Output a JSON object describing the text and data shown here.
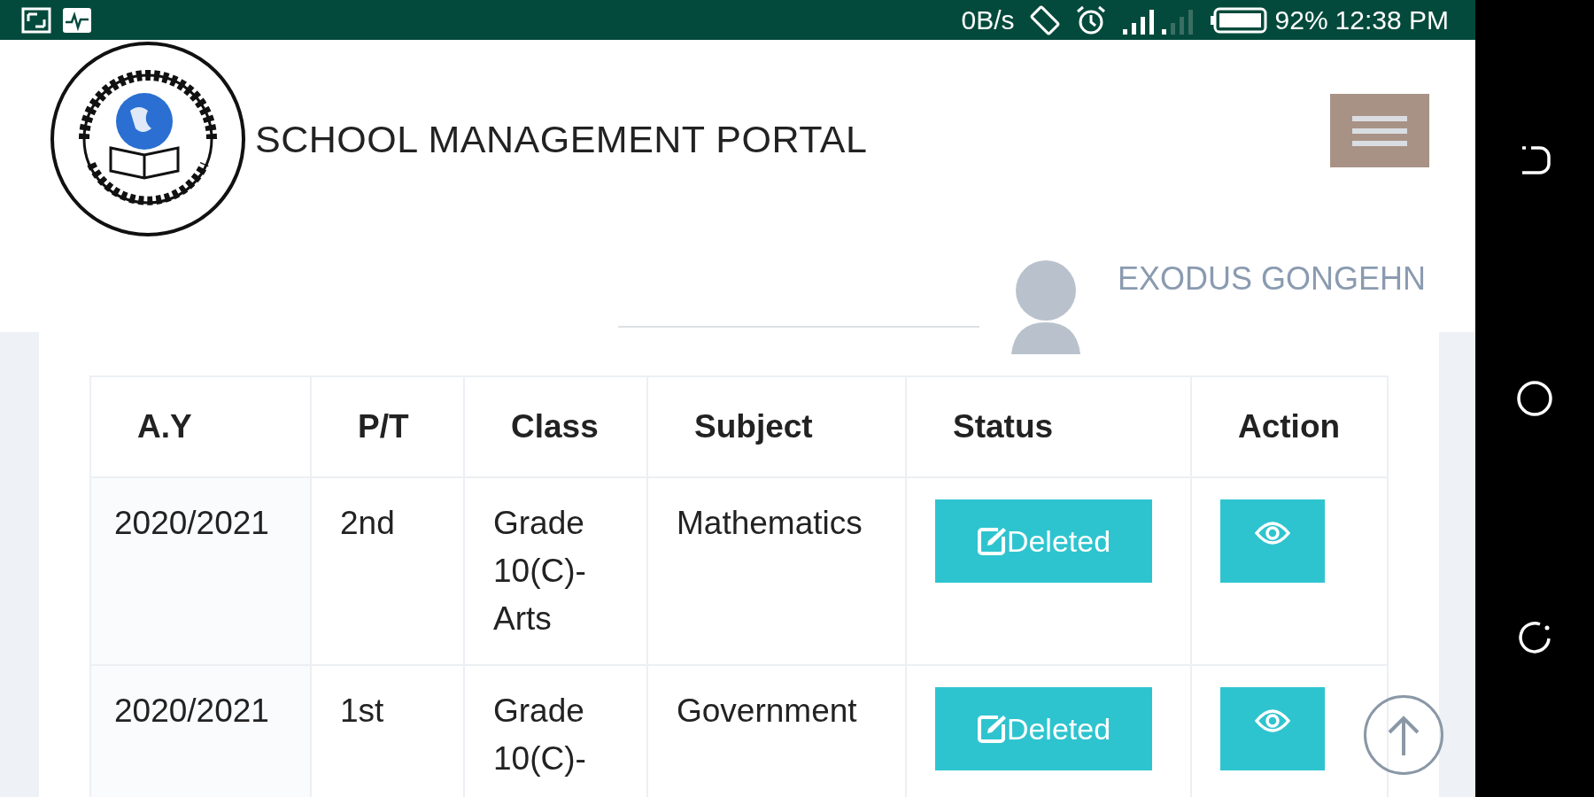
{
  "status_bar": {
    "net_speed": "0B/s",
    "battery": "92%",
    "time": "12:38 PM"
  },
  "header": {
    "title": "SCHOOL MANAGEMENT PORTAL"
  },
  "user": {
    "name": "EXODUS GONGEHN"
  },
  "table": {
    "columns": [
      "A.Y",
      "P/T",
      "Class",
      "Subject",
      "Status",
      "Action"
    ],
    "rows": [
      {
        "year": "2020/2021",
        "term": "2nd",
        "class": "Grade 10(C)-Arts",
        "subject": "Mathematics",
        "status": "Deleted"
      },
      {
        "year": "2020/2021",
        "term": "1st",
        "class": "Grade 10(C)-",
        "subject": "Government",
        "status": "Deleted"
      }
    ]
  }
}
